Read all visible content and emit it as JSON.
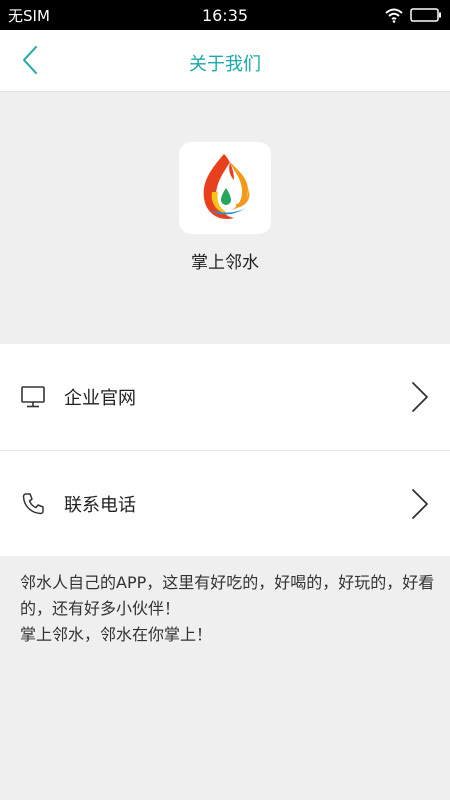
{
  "status_bar": {
    "carrier": "无SIM",
    "time": "16:35"
  },
  "nav": {
    "title": "关于我们",
    "back_icon": "chevron-left-icon"
  },
  "app": {
    "name": "掌上邻水",
    "logo_icon": "flame-water-logo"
  },
  "menu": [
    {
      "label": "企业官网",
      "icon": "monitor-icon"
    },
    {
      "label": "联系电话",
      "icon": "phone-icon"
    }
  ],
  "description": {
    "line1": "邻水人自己的APP，这里有好吃的，好喝的，好玩的，好看的，还有好多小伙伴！",
    "line2": "掌上邻水，邻水在你掌上！"
  },
  "colors": {
    "accent": "#1aa8a8",
    "background": "#efefef"
  }
}
